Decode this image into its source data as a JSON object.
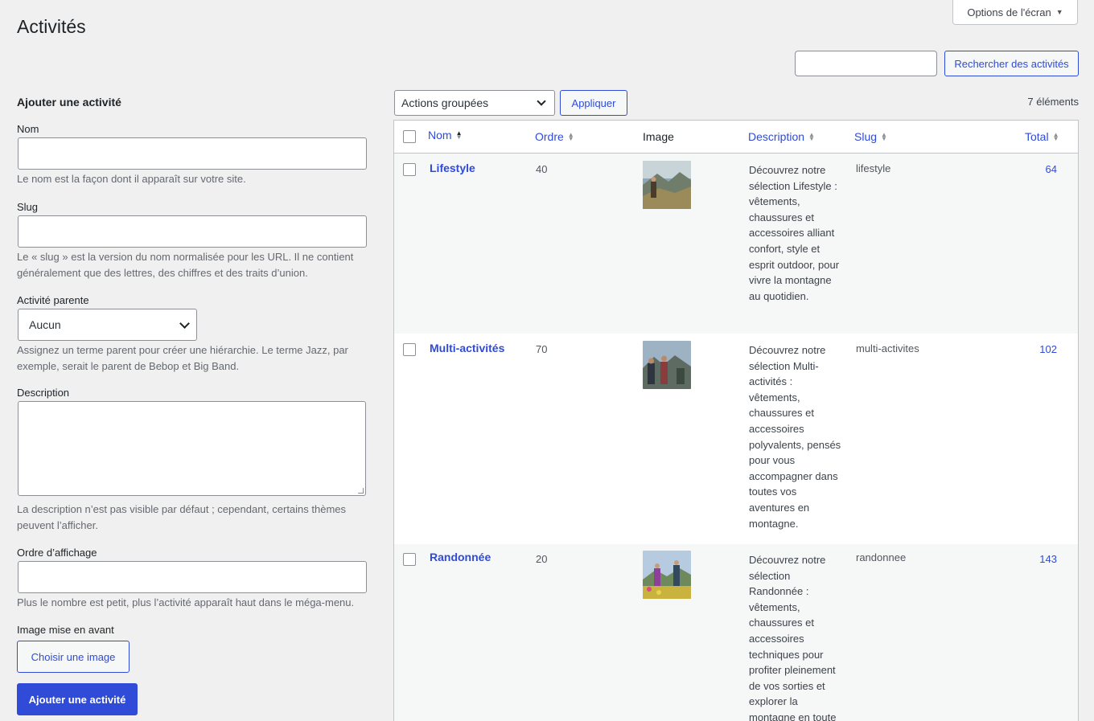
{
  "page": {
    "title": "Activités"
  },
  "screen_options": {
    "label": "Options de l'écran"
  },
  "search": {
    "placeholder": "",
    "button": "Rechercher des activités"
  },
  "form": {
    "heading": "Ajouter une activité",
    "name_label": "Nom",
    "name_help": "Le nom est la façon dont il apparaît sur votre site.",
    "slug_label": "Slug",
    "slug_help": "Le « slug » est la version du nom normalisée pour les URL. Il ne contient généralement que des lettres, des chiffres et des traits d’union.",
    "parent_label": "Activité parente",
    "parent_value": "Aucun",
    "parent_help": "Assignez un terme parent pour créer une hiérarchie. Le terme Jazz, par exemple, serait le parent de Bebop et Big Band.",
    "description_label": "Description",
    "description_help": "La description n’est pas visible par défaut ; cependant, certains thèmes peuvent l’afficher.",
    "order_label": "Ordre d’affichage",
    "order_help": "Plus le nombre est petit, plus l’activité apparaît haut dans le méga-menu.",
    "image_label": "Image mise en avant",
    "choose_image_button": "Choisir une image",
    "submit_button": "Ajouter une activité"
  },
  "bulk": {
    "selected": "Actions groupées",
    "apply_button": "Appliquer"
  },
  "items_count": "7 éléments",
  "table": {
    "columns": {
      "name": "Nom",
      "order": "Ordre",
      "image": "Image",
      "description": "Description",
      "slug": "Slug",
      "total": "Total"
    },
    "rows": [
      {
        "name": "Lifestyle",
        "order": "40",
        "description": "Découvrez notre sélection Lifestyle : vêtements, chaussures et accessoires alliant confort, style et esprit outdoor, pour vivre la montagne au quotidien.",
        "slug": "lifestyle",
        "total": "64"
      },
      {
        "name": "Multi-activités",
        "order": "70",
        "description": "Découvrez notre sélection Multi-activités : vêtements, chaussures et accessoires polyvalents, pensés pour vous accompagner dans toutes vos aventures en montagne.",
        "slug": "multi-activites",
        "total": "102"
      },
      {
        "name": "Randonnée",
        "order": "20",
        "description": "Découvrez notre sélection Randonnée : vêtements, chaussures et accessoires techniques pour profiter pleinement de vos sorties et explorer la montagne en toute",
        "slug": "randonnee",
        "total": "143"
      }
    ]
  },
  "colors": {
    "accent": "#2f4bd8",
    "background": "#f0f0f1"
  }
}
